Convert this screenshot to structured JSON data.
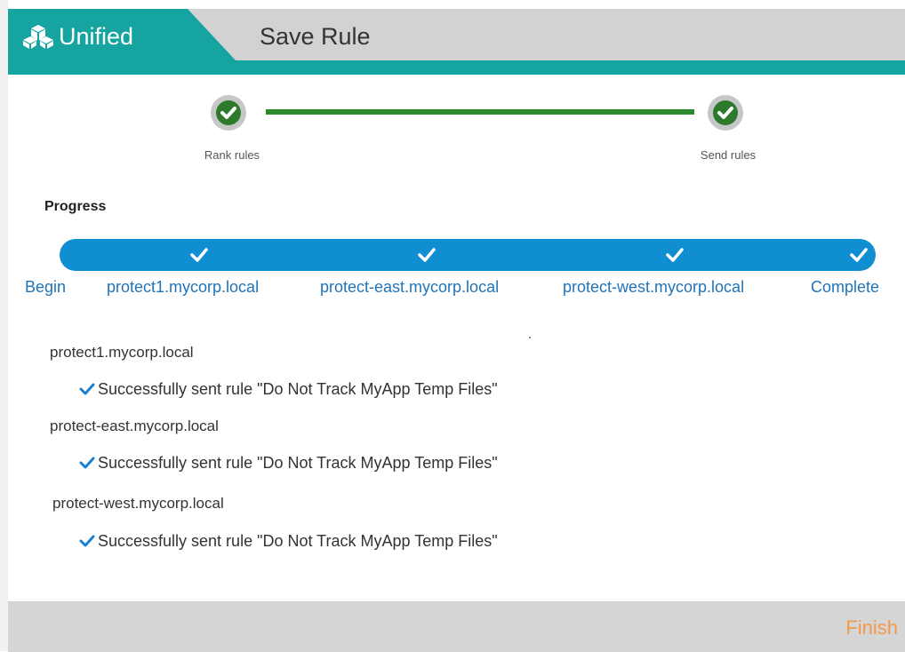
{
  "header": {
    "brand_title": "Unified",
    "brand_icon": "cubes-icon",
    "page_title": "Save Rule"
  },
  "stepper": {
    "steps": [
      {
        "label": "Rank rules",
        "status": "complete"
      },
      {
        "label": "Send rules",
        "status": "complete"
      }
    ]
  },
  "progress": {
    "heading": "Progress",
    "stages": [
      {
        "label": "Begin",
        "done": true
      },
      {
        "label": "protect1.mycorp.local",
        "done": true
      },
      {
        "label": "protect-east.mycorp.local",
        "done": true
      },
      {
        "label": "protect-west.mycorp.local",
        "done": true
      },
      {
        "label": "Complete",
        "done": true
      }
    ]
  },
  "results": [
    {
      "host": "protect1.mycorp.local",
      "message": "Successfully sent rule \"Do Not Track MyApp Temp Files\""
    },
    {
      "host": "protect-east.mycorp.local",
      "message": "Successfully sent rule \"Do Not Track MyApp Temp Files\""
    },
    {
      "host": "protect-west.mycorp.local",
      "message": "Successfully sent rule \"Do Not Track MyApp Temp Files\""
    }
  ],
  "footer": {
    "finish_label": "Finish"
  },
  "colors": {
    "teal": "#16a4a0",
    "progress_blue": "#0f8ed1",
    "step_green": "#2d7a2d",
    "check_blue": "#1a7fd0",
    "finish_orange": "#f09a4a"
  }
}
